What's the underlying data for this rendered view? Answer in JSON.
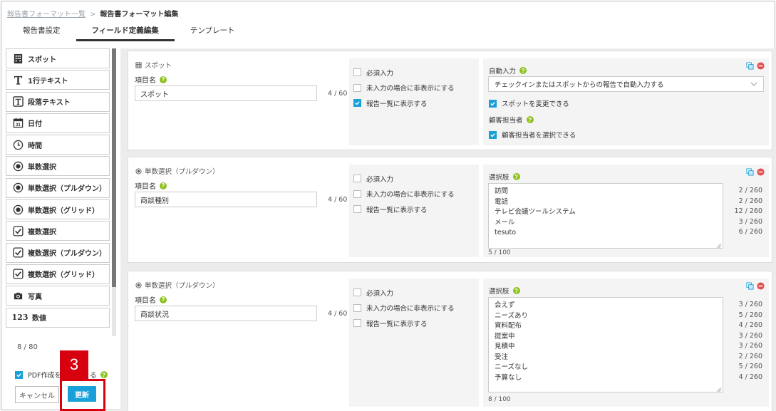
{
  "breadcrumb": {
    "parent": "報告書フォーマット一覧",
    "separator": ">",
    "current": "報告書フォーマット編集"
  },
  "tabs": [
    {
      "label": "報告書設定",
      "active": false
    },
    {
      "label": "フィールド定義編集",
      "active": true
    },
    {
      "label": "テンプレート",
      "active": false
    }
  ],
  "sidebar": {
    "items": [
      {
        "icon": "grid-icon",
        "label": "スポット"
      },
      {
        "icon": "text-t-icon",
        "label": "1行テキスト"
      },
      {
        "icon": "boxed-t-icon",
        "label": "段落テキスト"
      },
      {
        "icon": "calendar-icon",
        "label": "日付"
      },
      {
        "icon": "clock-icon",
        "label": "時間"
      },
      {
        "icon": "radio-icon",
        "label": "単数選択"
      },
      {
        "icon": "radio-icon",
        "label": "単数選択（プルダウン）"
      },
      {
        "icon": "radio-icon",
        "label": "単数選択（グリッド）"
      },
      {
        "icon": "checkbox-icon",
        "label": "複数選択"
      },
      {
        "icon": "checkbox-icon",
        "label": "複数選択（プルダウン）"
      },
      {
        "icon": "checkbox-icon",
        "label": "複数選択（グリッド）"
      },
      {
        "icon": "camera-icon",
        "label": "写真"
      },
      {
        "icon": "number-icon",
        "label": "数値",
        "icon_text": "123"
      }
    ],
    "count": "8 / 80",
    "pdf_label": "PDF作成を",
    "pdf_label_tail": "る",
    "pdf_checked": true,
    "help_mark": "?"
  },
  "buttons": {
    "cancel": "キャンセル",
    "update": "更新"
  },
  "highlight": {
    "number": "3",
    "color": "#d7000f"
  },
  "colors": {
    "accent": "#1aa0d8",
    "help": "#8dc21f",
    "delete": "#e05050"
  },
  "cards": [
    {
      "type_label": "スポット",
      "type_icon": "grid-icon",
      "item_label": "項目名",
      "item_value": "スポット",
      "char_count": "4 / 60",
      "options": [
        {
          "label": "必須入力",
          "checked": false
        },
        {
          "label": "未入力の場合に非表示にする",
          "checked": false
        },
        {
          "label": "報告一覧に表示する",
          "checked": true
        }
      ],
      "right": {
        "title": "自動入力",
        "select_value": "チェックインまたはスポットからの報告で自動入力する",
        "checks": [
          {
            "label": "スポットを変更できる",
            "checked": true
          }
        ],
        "subtitle": "顧客担当者",
        "checks2": [
          {
            "label": "顧客担当者を選択できる",
            "checked": true
          }
        ]
      }
    },
    {
      "type_label": "単数選択（プルダウン）",
      "type_icon": "radio-icon",
      "item_label": "項目名",
      "item_value": "商談種別",
      "char_count": "4 / 60",
      "options": [
        {
          "label": "必須入力",
          "checked": false
        },
        {
          "label": "未入力の場合に非表示にする",
          "checked": false
        },
        {
          "label": "報告一覧に表示する",
          "checked": false
        }
      ],
      "right": {
        "title": "選択肢",
        "choices": [
          {
            "text": "訪問",
            "count": "2 / 260"
          },
          {
            "text": "電話",
            "count": "2 / 260"
          },
          {
            "text": "テレビ会議ツールシステム",
            "count": "12 / 260"
          },
          {
            "text": "メール",
            "count": "3 / 260"
          },
          {
            "text": "tesuto",
            "count": "6 / 260"
          }
        ],
        "total": "5 / 100"
      }
    },
    {
      "type_label": "単数選択（プルダウン）",
      "type_icon": "radio-icon",
      "item_label": "項目名",
      "item_value": "商談状況",
      "char_count": "4 / 60",
      "options": [
        {
          "label": "必須入力",
          "checked": false
        },
        {
          "label": "未入力の場合に非表示にする",
          "checked": false
        },
        {
          "label": "報告一覧に表示する",
          "checked": false
        }
      ],
      "right": {
        "title": "選択肢",
        "choices": [
          {
            "text": "会えず",
            "count": "3 / 260"
          },
          {
            "text": "ニーズあり",
            "count": "5 / 260"
          },
          {
            "text": "資料配布",
            "count": "4 / 260"
          },
          {
            "text": "提案中",
            "count": "3 / 260"
          },
          {
            "text": "見積中",
            "count": "3 / 260"
          },
          {
            "text": "受注",
            "count": "2 / 260"
          },
          {
            "text": "ニーズなし",
            "count": "5 / 260"
          },
          {
            "text": "予算なし",
            "count": "4 / 260"
          }
        ],
        "total": "8 / 100"
      }
    }
  ]
}
